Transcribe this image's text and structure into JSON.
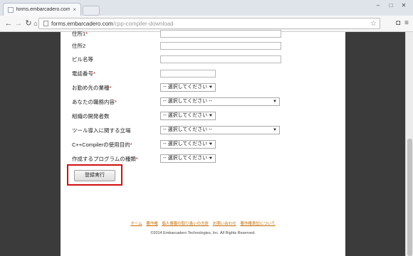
{
  "browser": {
    "tab_title": "forms.embarcadero.com/cp",
    "tab_close": "×",
    "url_domain": "forms.embarcadero.com",
    "url_path": "/cpp-compiler-download"
  },
  "form": {
    "rows": [
      {
        "label": "住所1",
        "required": "*",
        "kind": "input"
      },
      {
        "label": "住所2",
        "required": "",
        "kind": "input"
      },
      {
        "label": "ビル名等",
        "required": "",
        "kind": "input"
      },
      {
        "label": "電話番号",
        "required": "*",
        "kind": "input-short"
      },
      {
        "label": "お勤め先の業種",
        "required": "*",
        "kind": "select-short",
        "value": "-- 選択してください --"
      },
      {
        "label": "あなたの職務内容",
        "required": "*",
        "kind": "select-long",
        "value": "-- 選択してください --"
      },
      {
        "label": "組織の開発者数",
        "required": "",
        "kind": "select-short",
        "value": "-- 選択してください --"
      },
      {
        "label": "ツール導入に関する立場",
        "required": "",
        "kind": "select-long",
        "value": "-- 選択してください --"
      },
      {
        "label": "C++Compilerの使用目的",
        "required": "*",
        "kind": "select-short",
        "value": "-- 選択してください --"
      },
      {
        "label": "作成するプログラムの種類",
        "required": "*",
        "kind": "select-short",
        "value": "-- 選択してください --"
      }
    ],
    "submit_label": "登録実行"
  },
  "footer": {
    "links": [
      "ホーム",
      "著作権",
      "個人情報の取り扱いの方針",
      "お問い合わせ",
      "著作権表記について"
    ],
    "copyright": "©2014 Embarcadero Technologies, Inc. All Rights Reserved."
  }
}
